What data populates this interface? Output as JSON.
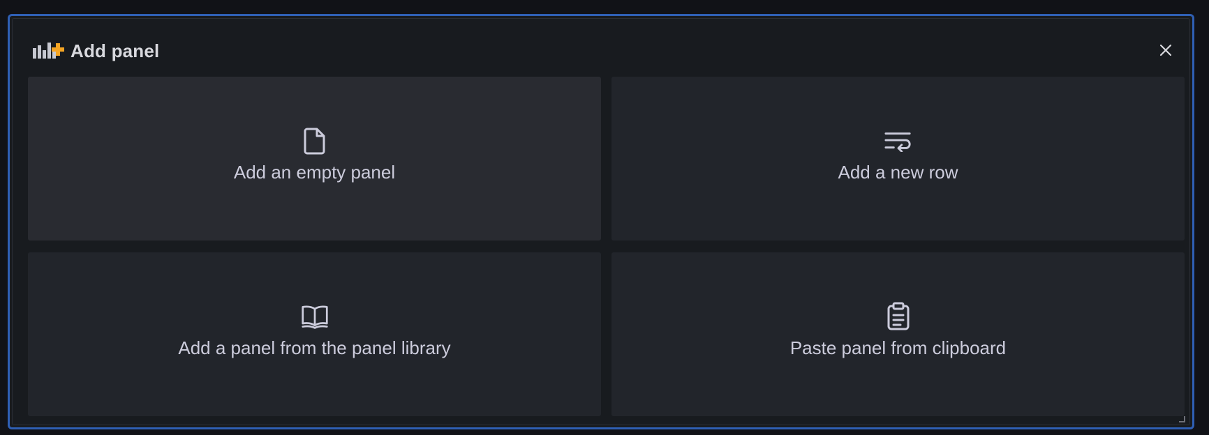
{
  "dialog": {
    "title": "Add panel",
    "accent_color": "#2f5fb4",
    "icon": "add-panel-icon",
    "close_icon": "close-icon"
  },
  "options": [
    {
      "label": "Add an empty panel",
      "icon": "file-blank-icon"
    },
    {
      "label": "Add a new row",
      "icon": "wrap-text-icon"
    },
    {
      "label": "Add a panel from the panel library",
      "icon": "book-open-icon"
    },
    {
      "label": "Paste panel from clipboard",
      "icon": "clipboard-icon"
    }
  ]
}
